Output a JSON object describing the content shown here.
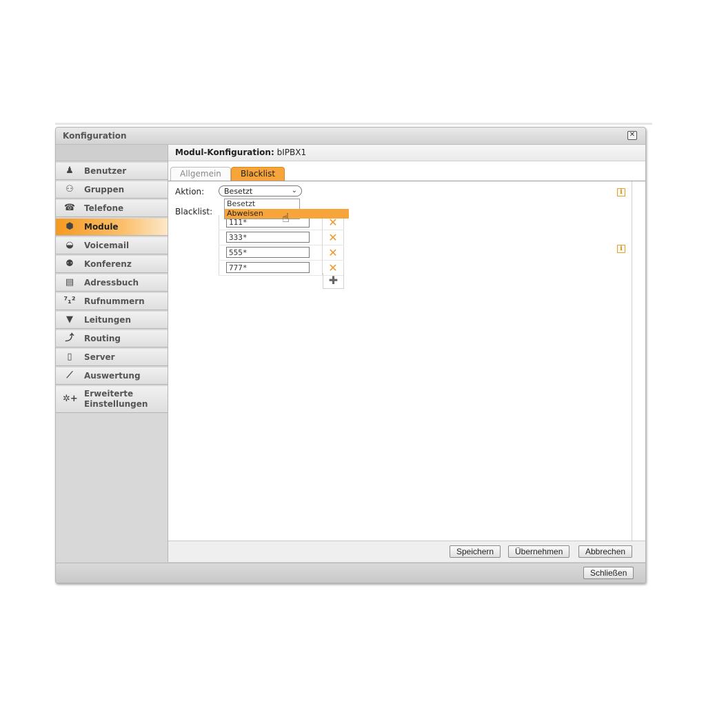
{
  "window": {
    "title": "Konfiguration",
    "close_label": "✕"
  },
  "sidebar": {
    "items": [
      {
        "label": "Benutzer",
        "icon": "user-icon",
        "glyph": "♟"
      },
      {
        "label": "Gruppen",
        "icon": "group-icon",
        "glyph": "⚇"
      },
      {
        "label": "Telefone",
        "icon": "phone-icon",
        "glyph": "☎"
      },
      {
        "label": "Module",
        "icon": "module-icon",
        "glyph": "⬢"
      },
      {
        "label": "Voicemail",
        "icon": "voicemail-icon",
        "glyph": "◒"
      },
      {
        "label": "Konferenz",
        "icon": "conference-icon",
        "glyph": "⚉"
      },
      {
        "label": "Adressbuch",
        "icon": "addressbook-icon",
        "glyph": "▤"
      },
      {
        "label": "Rufnummern",
        "icon": "numbers-icon",
        "glyph": "⁷₁²"
      },
      {
        "label": "Leitungen",
        "icon": "lines-icon",
        "glyph": "▼"
      },
      {
        "label": "Routing",
        "icon": "routing-icon",
        "glyph": "⤴"
      },
      {
        "label": "Server",
        "icon": "server-icon",
        "glyph": "▯"
      },
      {
        "label": "Auswertung",
        "icon": "chart-icon",
        "glyph": "⟋"
      },
      {
        "label_line1": "Erweiterte",
        "label_line2": "Einstellungen",
        "icon": "advanced-settings-icon",
        "glyph": "✲+"
      }
    ],
    "active": "Module"
  },
  "main": {
    "header_label": "Modul-Konfiguration:",
    "header_value": "bIPBX1",
    "tabs": [
      {
        "label": "Allgemein",
        "active": false
      },
      {
        "label": "Blacklist",
        "active": true
      }
    ],
    "aktion_label": "Aktion:",
    "aktion_value": "Besetzt",
    "dropdown_options": [
      "Besetzt",
      "Abweisen"
    ],
    "dropdown_highlighted": "Abweisen",
    "blacklist_label": "Blacklist:",
    "blacklist_entries": [
      "111*",
      "333*",
      "555*",
      "777*"
    ],
    "delete_glyph": "✕",
    "add_glyph": "✚",
    "info_glyph": "i"
  },
  "footer": {
    "save_label": "Speichern",
    "apply_label": "Übernehmen",
    "cancel_label": "Abbrechen",
    "close_label": "Schließen"
  },
  "colors": {
    "accent": "#f7a43a",
    "delete": "#f0962a"
  }
}
